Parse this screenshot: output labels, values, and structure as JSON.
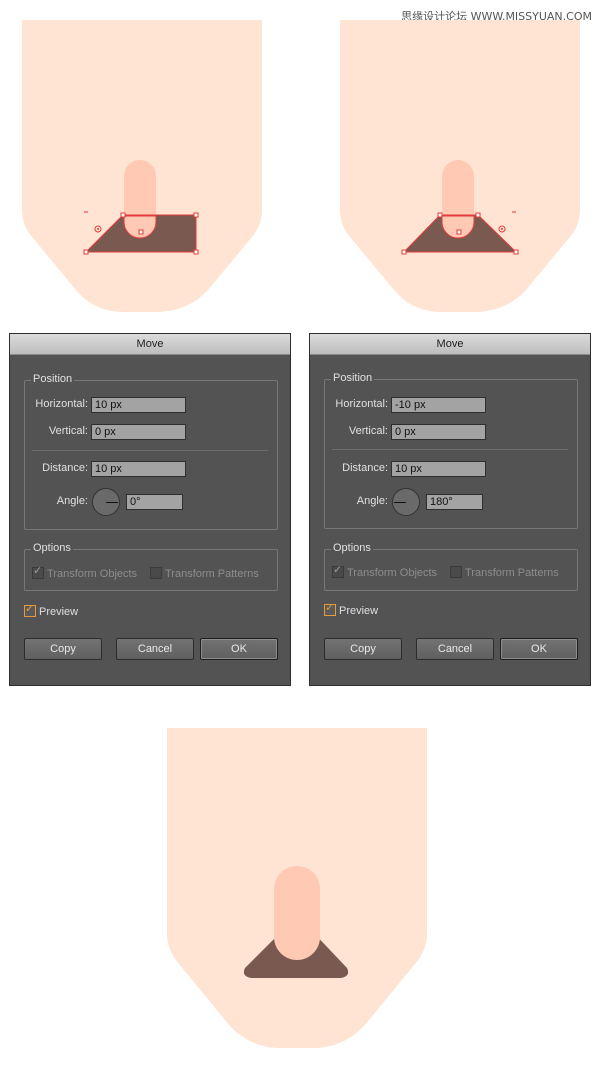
{
  "watermark": "思缘设计论坛 WWW.MISSYUAN.COM",
  "colors": {
    "skin": "#ffe4d3",
    "finger": "#ffc9b4",
    "shadow": "#7a5a50",
    "selection": "#e23a3a"
  },
  "dialogs": [
    {
      "title": "Move",
      "position_label": "Position",
      "horizontal_label": "Horizontal:",
      "horizontal_value": "10 px",
      "vertical_label": "Vertical:",
      "vertical_value": "0 px",
      "distance_label": "Distance:",
      "distance_value": "10 px",
      "angle_label": "Angle:",
      "angle_value": "0°",
      "options_label": "Options",
      "transform_objects": "Transform Objects",
      "transform_patterns": "Transform Patterns",
      "preview": "Preview",
      "copy": "Copy",
      "cancel": "Cancel",
      "ok": "OK"
    },
    {
      "title": "Move",
      "position_label": "Position",
      "horizontal_label": "Horizontal:",
      "horizontal_value": "-10 px",
      "vertical_label": "Vertical:",
      "vertical_value": "0 px",
      "distance_label": "Distance:",
      "distance_value": "10 px",
      "angle_label": "Angle:",
      "angle_value": "180°",
      "options_label": "Options",
      "transform_objects": "Transform Objects",
      "transform_patterns": "Transform Patterns",
      "preview": "Preview",
      "copy": "Copy",
      "cancel": "Cancel",
      "ok": "OK"
    }
  ]
}
